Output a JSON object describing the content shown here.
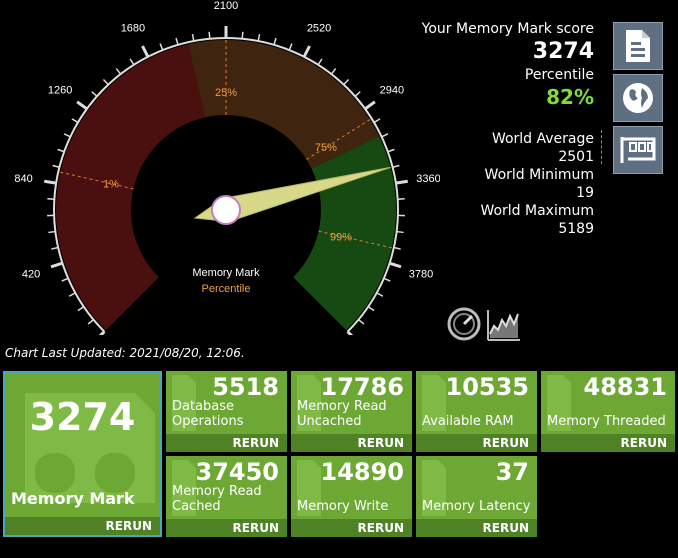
{
  "gauge": {
    "ticks": [
      "0",
      "420",
      "840",
      "1260",
      "1680",
      "2100",
      "2520",
      "2940",
      "3360",
      "3780",
      "4200"
    ],
    "percent_markers": [
      "1%",
      "25%",
      "75%",
      "99%"
    ],
    "center_label_1": "Memory Mark",
    "center_label_2": "Percentile",
    "max_value": 4200,
    "needle_value": 3274,
    "colors": {
      "red": "#4a0f0f",
      "brown": "#3f2410",
      "green": "#174a13"
    }
  },
  "score": {
    "title": "Your Memory Mark score",
    "value": "3274",
    "percentile_label": "Percentile",
    "percentile_value": "82%",
    "world_average_label": "World Average",
    "world_average": "2501",
    "world_minimum_label": "World Minimum",
    "world_minimum": "19",
    "world_maximum_label": "World Maximum",
    "world_maximum": "5189"
  },
  "side_buttons": [
    "document-icon",
    "globe-icon",
    "memory-card-icon"
  ],
  "chart_updated": "Chart Last Updated: 2021/08/20, 12:06.",
  "main_tile": {
    "value": "3274",
    "name": "Memory Mark",
    "rerun": "RERUN"
  },
  "tiles": [
    {
      "value": "5518",
      "name_1": "Database",
      "name_2": "Operations",
      "rerun": "RERUN"
    },
    {
      "value": "17786",
      "name_1": "Memory Read",
      "name_2": "Uncached",
      "rerun": "RERUN"
    },
    {
      "value": "10535",
      "name_1": "",
      "name_2": "Available RAM",
      "rerun": "RERUN"
    },
    {
      "value": "48831",
      "name_1": "",
      "name_2": "Memory Threaded",
      "rerun": "RERUN"
    },
    {
      "value": "37450",
      "name_1": "Memory Read",
      "name_2": "Cached",
      "rerun": "RERUN"
    },
    {
      "value": "14890",
      "name_1": "",
      "name_2": "Memory Write",
      "rerun": "RERUN"
    },
    {
      "value": "37",
      "name_1": "",
      "name_2": "Memory Latency",
      "rerun": "RERUN"
    }
  ]
}
